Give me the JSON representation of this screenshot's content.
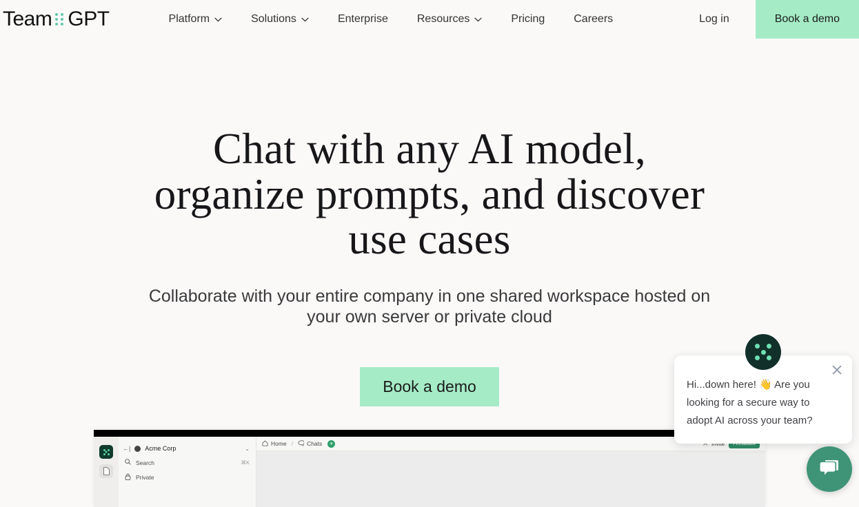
{
  "brand": {
    "logo_text_1": "Team",
    "logo_text_2": "GPT",
    "accent_mint": "#a5ecc6",
    "accent_green": "#3f9478",
    "dark_green": "#12302a",
    "dot_green": "#63c6a8",
    "page_bg": "#faf9f8"
  },
  "header": {
    "nav": [
      {
        "label": "Platform",
        "has_dropdown": true
      },
      {
        "label": "Solutions",
        "has_dropdown": true
      },
      {
        "label": "Enterprise",
        "has_dropdown": false
      },
      {
        "label": "Resources",
        "has_dropdown": true
      },
      {
        "label": "Pricing",
        "has_dropdown": false
      },
      {
        "label": "Careers",
        "has_dropdown": false
      }
    ],
    "login_label": "Log in",
    "demo_label": "Book a demo"
  },
  "hero": {
    "title": "Chat with any AI model, organize prompts, and discover use cases",
    "subtitle": "Collaborate with your entire company in one shared workspace hosted on your own server or private cloud",
    "cta_label": "Book a demo"
  },
  "app_screenshot": {
    "workspace_name": "Acme Corp",
    "search_label": "Search",
    "search_shortcut": "⌘K",
    "private_label": "Private",
    "breadcrumb_home": "Home",
    "breadcrumb_sep": "/",
    "breadcrumb_chats": "Chats",
    "new_chat_icon": "plus-icon",
    "invite_label": "Invite",
    "feedback_label": "Feedback"
  },
  "chat_widget": {
    "message": "Hi...down here! 👋 Are you looking for a secure way to adopt AI across your team?",
    "close_icon": "close-icon",
    "launcher_icon": "chat-bubble-icon",
    "avatar_icon": "teamgpt-dots-avatar"
  }
}
